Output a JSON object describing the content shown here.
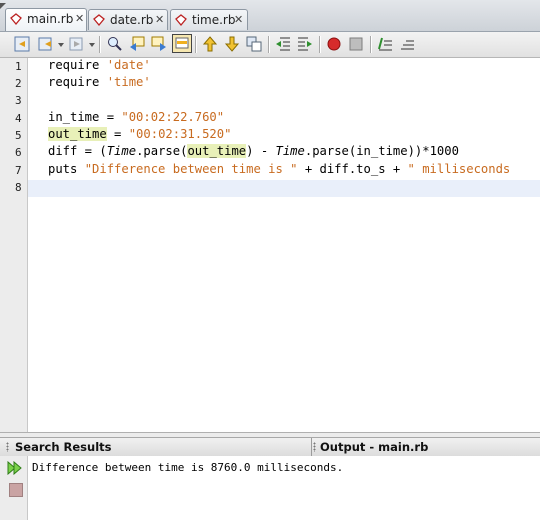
{
  "tabs": [
    {
      "label": "main.rb",
      "active": true
    },
    {
      "label": "date.rb",
      "active": false
    },
    {
      "label": "time.rb",
      "active": false
    }
  ],
  "tab_close_glyph": "✕",
  "toolbar_icons": [
    "back-icon",
    "history-icon",
    "forward-icon",
    "find-icon",
    "prev-occurrence-icon",
    "next-occurrence-icon",
    "toggle-highlight-icon",
    "prev-bookmark-icon",
    "next-bookmark-icon",
    "toggle-bookmark-icon",
    "shift-left-icon",
    "shift-right-icon",
    "record-macro-icon",
    "stop-macro-icon",
    "comment-icon",
    "uncomment-icon"
  ],
  "editor": {
    "line_numbers": [
      "1",
      "2",
      "3",
      "4",
      "5",
      "6",
      "7",
      "8"
    ],
    "lines": [
      {
        "kw": "require ",
        "str": "'date'"
      },
      {
        "kw": "require ",
        "str": "'time'"
      },
      {},
      {
        "lhs": "in_time = ",
        "str": "\"00:02:22.760\""
      },
      {
        "var": "out_time",
        "lhs": " = ",
        "str": "\"00:02:31.520\""
      },
      {
        "a": "diff = (",
        "cls1": "Time",
        "b": ".parse(",
        "var": "out_time",
        "c": ") - ",
        "cls2": "Time",
        "d": ".parse(in_time))*1000"
      },
      {
        "a": "puts ",
        "str1": "\"Difference between time is \"",
        "b": " + diff.to_s + ",
        "str2": "\" milliseconds"
      },
      {}
    ]
  },
  "panels": {
    "search_results": "Search Results",
    "output": "Output - main.rb"
  },
  "output_text": "Difference between time is 8760.0 milliseconds.",
  "colors": {
    "string": "#c86b20",
    "highlight": "#e8f0b8",
    "current_line": "#e9effa"
  }
}
